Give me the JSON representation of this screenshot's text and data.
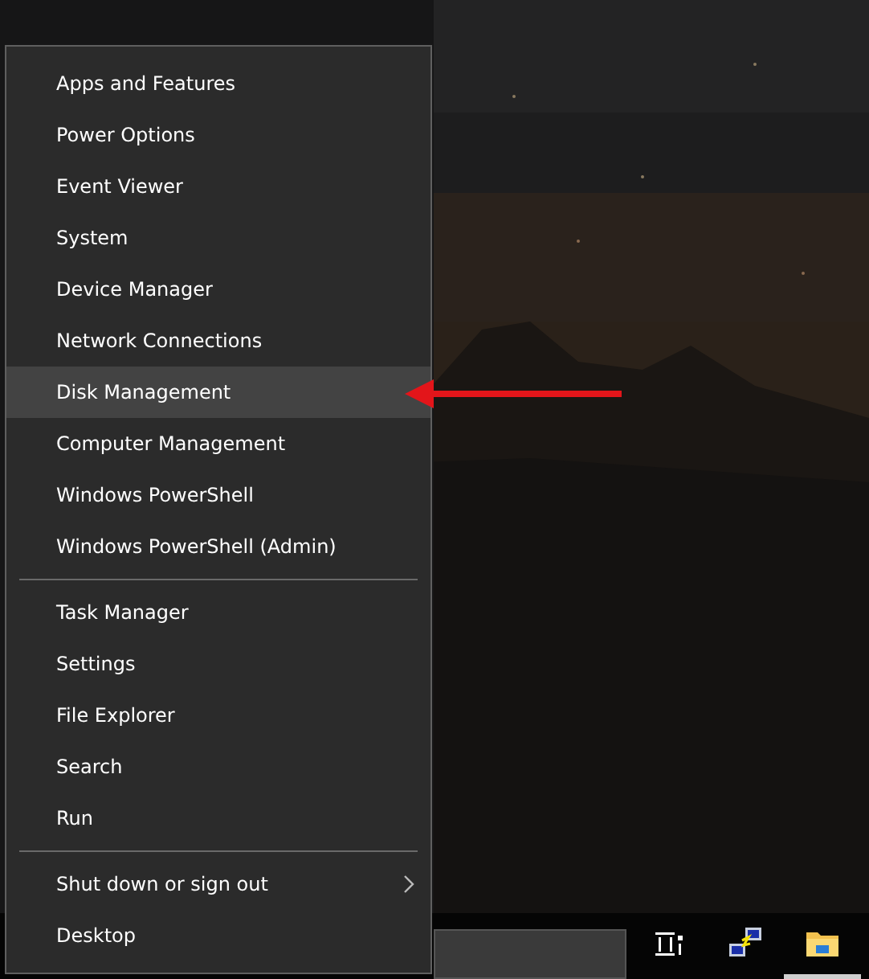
{
  "menu": {
    "groups": [
      {
        "items": [
          {
            "label": "Apps and Features",
            "selected": false
          },
          {
            "label": "Power Options",
            "selected": false
          },
          {
            "label": "Event Viewer",
            "selected": false
          },
          {
            "label": "System",
            "selected": false
          },
          {
            "label": "Device Manager",
            "selected": false
          },
          {
            "label": "Network Connections",
            "selected": false
          },
          {
            "label": "Disk Management",
            "selected": true
          },
          {
            "label": "Computer Management",
            "selected": false
          },
          {
            "label": "Windows PowerShell",
            "selected": false
          },
          {
            "label": "Windows PowerShell (Admin)",
            "selected": false
          }
        ]
      },
      {
        "items": [
          {
            "label": "Task Manager",
            "selected": false
          },
          {
            "label": "Settings",
            "selected": false
          },
          {
            "label": "File Explorer",
            "selected": false
          },
          {
            "label": "Search",
            "selected": false
          },
          {
            "label": "Run",
            "selected": false
          }
        ]
      },
      {
        "items": [
          {
            "label": "Shut down or sign out",
            "selected": false,
            "submenu": true
          },
          {
            "label": "Desktop",
            "selected": false
          }
        ]
      }
    ]
  },
  "taskbar": {
    "apps": [
      {
        "kind": "taskview",
        "active": false
      },
      {
        "kind": "network",
        "active": false
      },
      {
        "kind": "folder",
        "active": true
      }
    ]
  }
}
